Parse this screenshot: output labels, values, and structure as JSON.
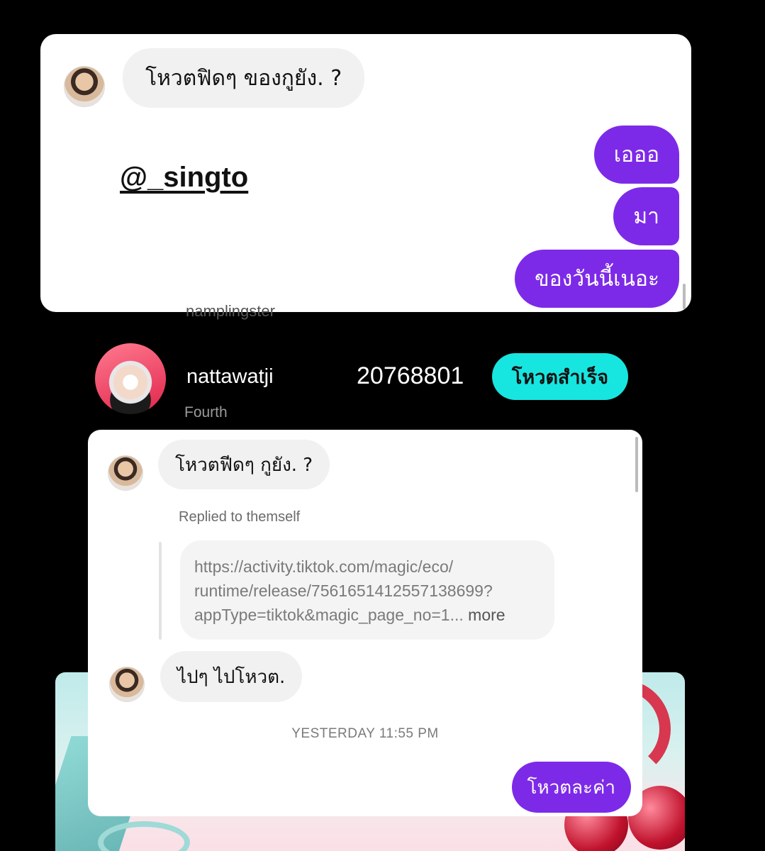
{
  "top_chat": {
    "incoming_message": "โหวตฟิดๆ ของกูยัง. ?",
    "threads_link": "@_singto",
    "outgoing_messages": [
      "เอออ",
      "มา",
      "ของวันนี้เนอะ"
    ]
  },
  "ranking_row": {
    "hidden_username": "namplingster",
    "username": "nattawatji",
    "subtitle": "Fourth",
    "vote_count": "20768801",
    "vote_button_label": "โหวตสำเร็จ",
    "vote_button_color": "#17e6e0"
  },
  "bottom_chat": {
    "incoming_message_1": "โหวตฟีดๆ กูยัง. ?",
    "replied_label": "Replied to themself",
    "quoted_link_lines": [
      "https://activity.tiktok.com/magic/eco/",
      "runtime/release/7561651412557138699?",
      "appType=tiktok&magic_page_no=1..."
    ],
    "quoted_more": "more",
    "incoming_message_2": "ไปๆ ไปโหวต.",
    "timestamp": "YESTERDAY 11:55 PM",
    "outgoing_message": "โหวตละค่า"
  },
  "colors": {
    "outgoing_bubble": "#7d2ae8",
    "incoming_bubble": "#f1f1f2",
    "background": "#000000"
  }
}
